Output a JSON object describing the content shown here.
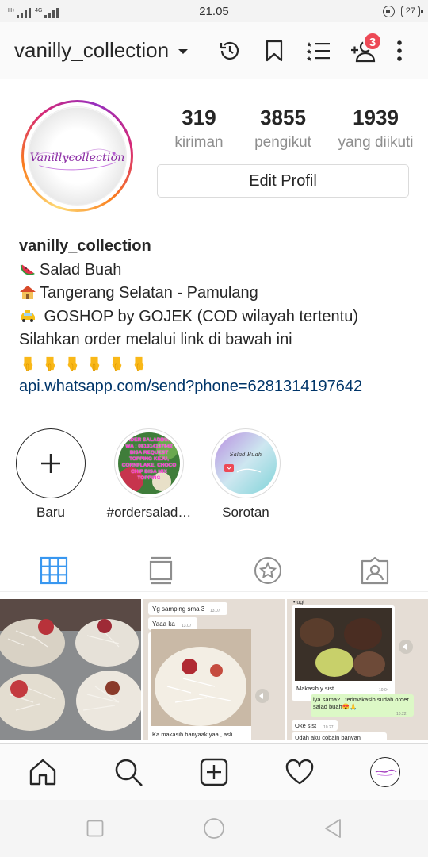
{
  "status_bar": {
    "time": "21.05",
    "net1": "H+",
    "net2": "4G",
    "battery": "27"
  },
  "header": {
    "username": "vanilly_collection",
    "notification_count": "3",
    "icons": [
      "history-icon",
      "bookmark-icon",
      "list-icon",
      "add-user-icon",
      "more-icon"
    ]
  },
  "profile": {
    "avatar_text": "Vanillycollection",
    "stats": [
      {
        "value": "319",
        "label": "kiriman"
      },
      {
        "value": "3855",
        "label": "pengikut"
      },
      {
        "value": "1939",
        "label": "yang diikuti"
      }
    ],
    "edit_button": "Edit Profil",
    "bio": {
      "name": "vanilly_collection",
      "line1": "Salad Buah",
      "line2": "Tangerang Selatan - Pamulang",
      "line3": " GOSHOP by GOJEK (COD wilayah tertentu)",
      "line4": "Silahkan order melalui link di bawah ini",
      "link": "api.whatsapp.com/send?phone=6281314197642"
    }
  },
  "highlights": [
    {
      "label": "Baru"
    },
    {
      "label": "#ordersalad…",
      "thumb_text": "ORDER SALADBUAH WA : 081314197642 BISA REQUEST TOPPING KEJU, CORNFLAKE, CHOCO CHIP BISA MIX TOPPING"
    },
    {
      "label": "Sorotan",
      "thumb_text": "Salad Buah"
    }
  ],
  "grid": {
    "post2": {
      "chat1": "Yg samping sma 3",
      "time1": "13.07",
      "chat2": "Yaaa ka",
      "time2": "13.07",
      "chat3": "Ka makasih banyaak yaa , asli"
    },
    "post3": {
      "chat0": "• ugt",
      "chat1": "Makasih y sist",
      "time1": "10.04",
      "chat2": "iya sama2...terimakasih sudah order salad buah😍🙏",
      "time2": "10.22",
      "chat3": "Oke sist",
      "time3": "10.27",
      "chat4": "Udah aku cobain banyan"
    }
  },
  "colors": {
    "accent": "#ed4956",
    "link": "#003569",
    "text": "#262626",
    "muted": "#8e8e8e",
    "tab_active": "#3897f0"
  }
}
